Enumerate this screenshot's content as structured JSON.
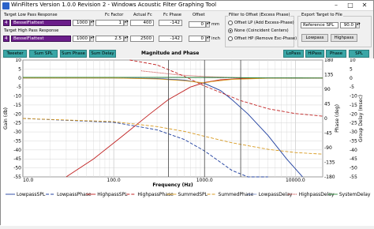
{
  "window": {
    "title": "WinFilters Version 1.0.0 Revision 2 - Windows Acoustic Filter Graphing Tool",
    "minimize_glyph": "–",
    "maximize_glyph": "□",
    "close_glyph": "✕"
  },
  "lowpass": {
    "label": "Target Low Pass Response",
    "order": "4",
    "type": "BesselFlattest",
    "value": "1000",
    "fc_factor": "1",
    "actual_fc": "400",
    "fc_phase": "-142"
  },
  "highpass": {
    "label": "Target High Pass Response",
    "order": "4",
    "type": "BesselFlattest",
    "value": "1000",
    "fc_factor": "2.5",
    "actual_fc": "2500",
    "fc_phase": "-142"
  },
  "headers": {
    "fc_factor": "Fc Factor",
    "actual_fc": "Actual Fc",
    "fc_phase": "Fc Phase",
    "offset": "Offset"
  },
  "offset": {
    "mm_value": "0",
    "mm_unit": "mm",
    "inch_value": "0",
    "inch_unit": "inch"
  },
  "filter_to_offset": {
    "label": "Filter to Offset (Excess Phase)",
    "options": [
      "Offset LP (Add Excess-Phase)",
      "None (Coincident Centers)",
      "Offset HP (Remove Exc-Phase)"
    ],
    "selected": 1
  },
  "export": {
    "label": "Export Target to File",
    "reference": "Reference SPL",
    "value": "90.0",
    "lowpass_button": "Lowpass",
    "highpass_button": "Highpass"
  },
  "toolbar": {
    "tweeter": "Tweeter",
    "sum_spl": "Sum SPL",
    "sum_phase": "Sum Phase",
    "sum_delay": "Sum Delay",
    "lopass": "LoPass",
    "hipass": "HiPass",
    "phase": "Phase",
    "spl": "SPL"
  },
  "chart_data": {
    "type": "line",
    "title": "Magnitude and Phase",
    "xlabel": "Frequency (Hz)",
    "ylabel": "Gain (db)",
    "y2label": "Phase (deg)",
    "y3label": "Group Delay (msec)",
    "x_scale": "log",
    "xlim": [
      10,
      20000
    ],
    "ylim": [
      -55,
      10
    ],
    "x_ticks": [
      "10.0",
      "100.0",
      "1000.0",
      "10000.0"
    ],
    "y_ticks": [
      "10",
      "5",
      "0",
      "-5",
      "-10",
      "-15",
      "-20",
      "-25",
      "-30",
      "-35",
      "-40",
      "-45",
      "-50",
      "-55"
    ],
    "y2_ticks": [
      "180",
      "135",
      "90",
      "45",
      "0",
      "-45",
      "-90",
      "-135",
      "-180"
    ],
    "y3_ticks": [
      "10",
      "5",
      "0",
      "-5",
      "-10",
      "-15",
      "-20",
      "-25",
      "-30",
      "-35",
      "-40",
      "-45",
      "-50",
      "-55"
    ],
    "grid": true,
    "legend_position": "bottom",
    "series": [
      {
        "name": "LowpassSPL",
        "color": "#1f3f9f",
        "dash": "solid",
        "points": [
          [
            10,
            0
          ],
          [
            100,
            0
          ],
          [
            300,
            -0.3
          ],
          [
            600,
            -1.2
          ],
          [
            1000,
            -3
          ],
          [
            1500,
            -7
          ],
          [
            2000,
            -12
          ],
          [
            3000,
            -20
          ],
          [
            5000,
            -32
          ],
          [
            8000,
            -45
          ],
          [
            12000,
            -55
          ]
        ]
      },
      {
        "name": "LowpassPhase",
        "color": "#1f3f9f",
        "dash": "4 2",
        "points": [
          [
            10,
            0
          ],
          [
            100,
            -12
          ],
          [
            300,
            -35
          ],
          [
            600,
            -65
          ],
          [
            1000,
            -100
          ],
          [
            1500,
            -135
          ],
          [
            2000,
            -160
          ],
          [
            3000,
            -190
          ],
          [
            5000,
            -220
          ]
        ]
      },
      {
        "name": "HighpassSPL",
        "color": "#c02020",
        "dash": "solid",
        "points": [
          [
            30,
            -55
          ],
          [
            60,
            -45
          ],
          [
            120,
            -33
          ],
          [
            250,
            -20
          ],
          [
            400,
            -12
          ],
          [
            700,
            -5
          ],
          [
            1000,
            -2.5
          ],
          [
            1500,
            -1
          ],
          [
            2500,
            -0.3
          ],
          [
            5000,
            0
          ],
          [
            20000,
            0
          ]
        ]
      },
      {
        "name": "HighpassPhase",
        "color": "#c02020",
        "dash": "4 2",
        "points": [
          [
            150,
            190
          ],
          [
            300,
            165
          ],
          [
            600,
            130
          ],
          [
            1000,
            100
          ],
          [
            1500,
            80
          ],
          [
            2500,
            55
          ],
          [
            5000,
            30
          ],
          [
            10000,
            15
          ],
          [
            20000,
            7
          ]
        ]
      },
      {
        "name": "SummedSPL",
        "color": "#d89a20",
        "dash": "solid",
        "points": [
          [
            10,
            0
          ],
          [
            100,
            0
          ],
          [
            300,
            -0.5
          ],
          [
            600,
            -1.5
          ],
          [
            900,
            -2.5
          ],
          [
            1000,
            -2.7
          ],
          [
            1200,
            -2
          ],
          [
            2000,
            -0.8
          ],
          [
            5000,
            -0.1
          ],
          [
            20000,
            0
          ]
        ]
      },
      {
        "name": "SummedPhase",
        "color": "#d89a20",
        "dash": "4 2",
        "points": [
          [
            10,
            0
          ],
          [
            100,
            -10
          ],
          [
            300,
            -25
          ],
          [
            600,
            -40
          ],
          [
            1000,
            -55
          ],
          [
            2000,
            -75
          ],
          [
            5000,
            -95
          ],
          [
            10000,
            -105
          ],
          [
            20000,
            -110
          ]
        ]
      },
      {
        "name": "LowpassDelay",
        "color": "#1f3f9f",
        "dash": "1 1",
        "points": [
          [
            10,
            0.4
          ],
          [
            100,
            0.4
          ],
          [
            300,
            0.4
          ],
          [
            600,
            0.35
          ],
          [
            1000,
            0.3
          ],
          [
            2000,
            0.15
          ],
          [
            5000,
            0.03
          ],
          [
            20000,
            0
          ]
        ]
      },
      {
        "name": "HighpassDelay",
        "color": "#c02020",
        "dash": "1 1",
        "points": [
          [
            200,
            4
          ],
          [
            300,
            3
          ],
          [
            500,
            1.8
          ],
          [
            1000,
            0.8
          ],
          [
            2000,
            0.3
          ],
          [
            5000,
            0.05
          ],
          [
            20000,
            0
          ]
        ]
      },
      {
        "name": "SystemDelay",
        "color": "#2a8a3a",
        "dash": "solid",
        "points": [
          [
            10,
            0.4
          ],
          [
            100,
            0.4
          ],
          [
            500,
            0.4
          ],
          [
            1000,
            0.35
          ],
          [
            2000,
            0.25
          ],
          [
            3000,
            0.1
          ],
          [
            5000,
            0.02
          ],
          [
            20000,
            0
          ]
        ]
      }
    ]
  }
}
